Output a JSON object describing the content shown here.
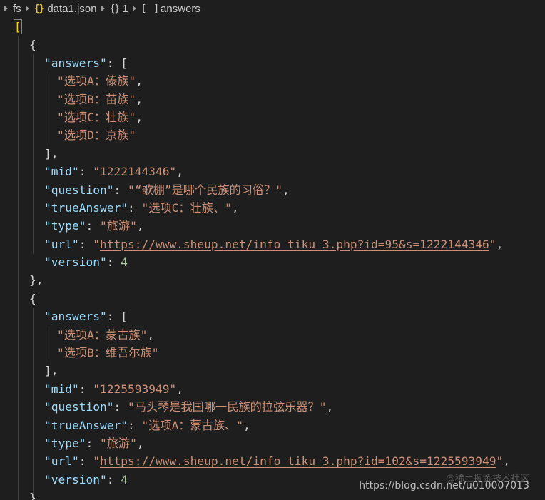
{
  "breadcrumb": {
    "folder": "fs",
    "file_icon": "{}",
    "file": "data1.json",
    "obj_icon": "{}",
    "index": "1",
    "arr_icon": "[ ]",
    "field": "answers"
  },
  "records": [
    {
      "answers_key": "\"answers\"",
      "answers": [
        "\"选项A：傣族\"",
        "\"选项B：苗族\"",
        "\"选项C：壮族\"",
        "\"选项D：京族\""
      ],
      "mid_key": "\"mid\"",
      "mid": "\"1222144346\"",
      "question_key": "\"question\"",
      "question": "\"“歌棚”是哪个民族的习俗？\"",
      "trueAnswer_key": "\"trueAnswer\"",
      "trueAnswer": "\"选项C：壮族、\"",
      "type_key": "\"type\"",
      "type": "\"旅游\"",
      "url_key": "\"url\"",
      "url": "https://www.sheup.net/info_tiku_3.php?id=95&s=1222144346",
      "version_key": "\"version\"",
      "version": "4"
    },
    {
      "answers_key": "\"answers\"",
      "answers": [
        "\"选项A：蒙古族\"",
        "\"选项B：维吾尔族\""
      ],
      "mid_key": "\"mid\"",
      "mid": "\"1225593949\"",
      "question_key": "\"question\"",
      "question": "\"马头琴是我国哪一民族的拉弦乐器？\"",
      "trueAnswer_key": "\"trueAnswer\"",
      "trueAnswer": "\"选项A：蒙古族、\"",
      "type_key": "\"type\"",
      "type": "\"旅游\"",
      "url_key": "\"url\"",
      "url": "https://www.sheup.net/info_tiku_3.php?id=102&s=1225593949",
      "version_key": "\"version\"",
      "version": "4"
    }
  ],
  "watermark": {
    "line1": "@稀土掘金技术社区",
    "line2": "https://blog.csdn.net/u010007013"
  },
  "colors": {
    "background": "#1e1e1e",
    "key": "#9cdcfe",
    "string": "#ce9178",
    "number": "#b5cea8",
    "bracket_highlight": "#ffd700"
  }
}
